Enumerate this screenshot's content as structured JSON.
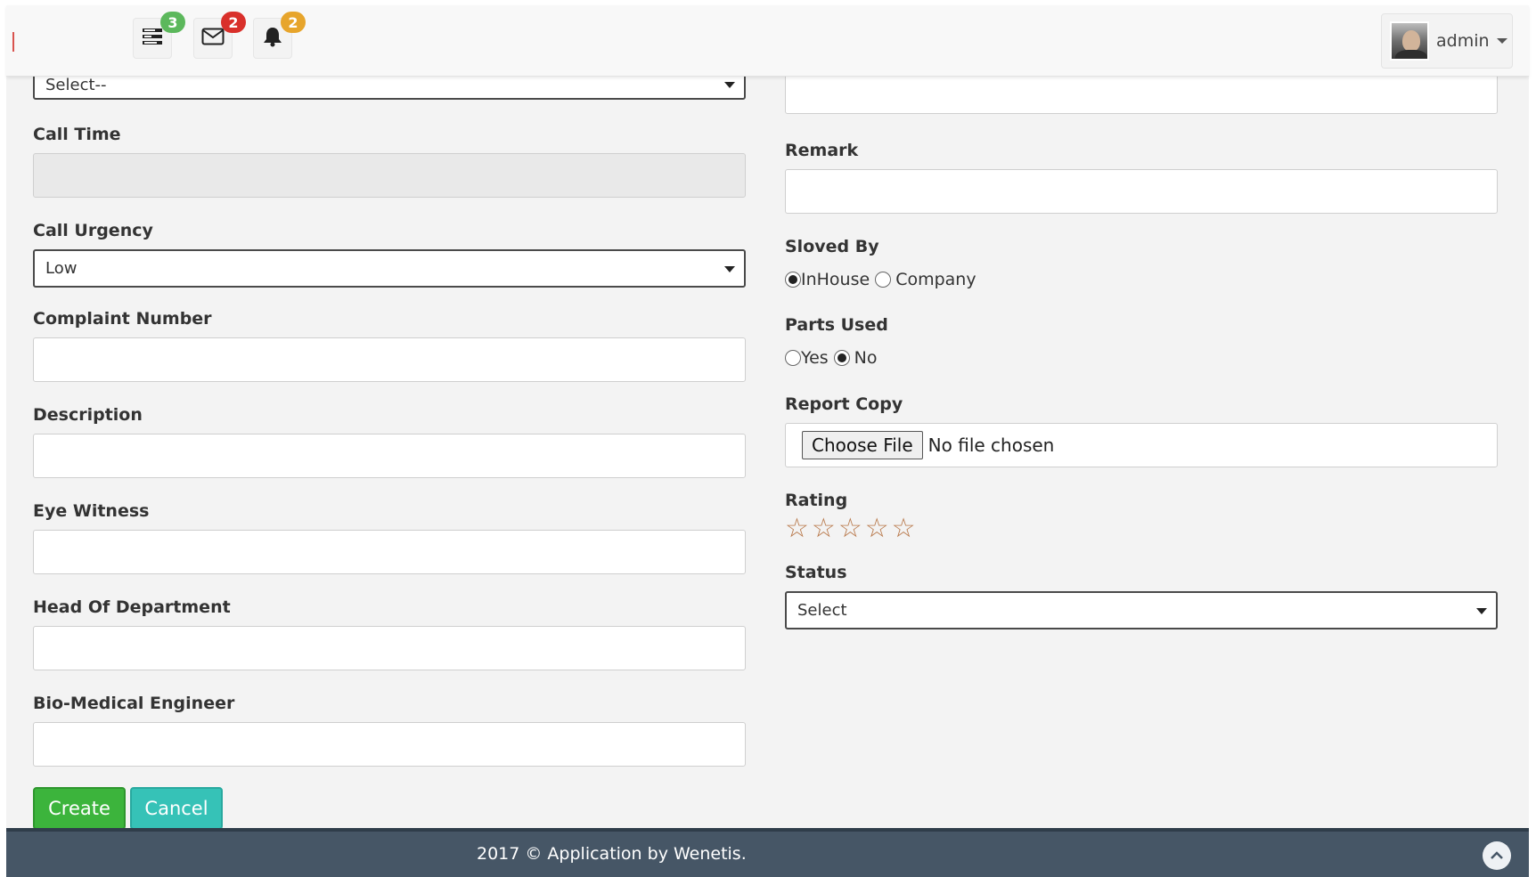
{
  "header": {
    "nav_icons": [
      {
        "icon": "tasks-icon",
        "badge": "3",
        "badge_color": "#5cb85c"
      },
      {
        "icon": "envelope-icon",
        "badge": "2",
        "badge_color": "#d9302b"
      },
      {
        "icon": "bell-icon",
        "badge": "2",
        "badge_color": "#e7a52c"
      }
    ],
    "user": {
      "name": "admin"
    }
  },
  "form": {
    "left": {
      "top_select_value": "Select--",
      "call_time_label": "Call Time",
      "call_time_value": "",
      "call_urgency_label": "Call Urgency",
      "call_urgency_value": "Low",
      "complaint_number_label": "Complaint Number",
      "complaint_number_value": "",
      "description_label": "Description",
      "description_value": "",
      "eye_witness_label": "Eye Witness",
      "eye_witness_value": "",
      "head_of_department_label": "Head Of Department",
      "head_of_department_value": "",
      "bio_medical_engineer_label": "Bio-Medical Engineer",
      "bio_medical_engineer_value": ""
    },
    "right": {
      "top_input_value": "",
      "remark_label": "Remark",
      "remark_value": "",
      "solved_by_label": "Sloved By",
      "solved_by_options": [
        "InHouse",
        "Company"
      ],
      "solved_by_selected": "InHouse",
      "parts_used_label": "Parts Used",
      "parts_used_options": [
        "Yes",
        "No"
      ],
      "parts_used_selected": "No",
      "report_copy_label": "Report Copy",
      "file_button_label": "Choose File",
      "file_status": "No file chosen",
      "rating_label": "Rating",
      "rating_value": 0,
      "rating_max": 5,
      "status_label": "Status",
      "status_value": "Select"
    },
    "buttons": {
      "create": "Create",
      "cancel": "Cancel"
    }
  },
  "footer": {
    "text": "2017 © Application by Wenetis."
  }
}
